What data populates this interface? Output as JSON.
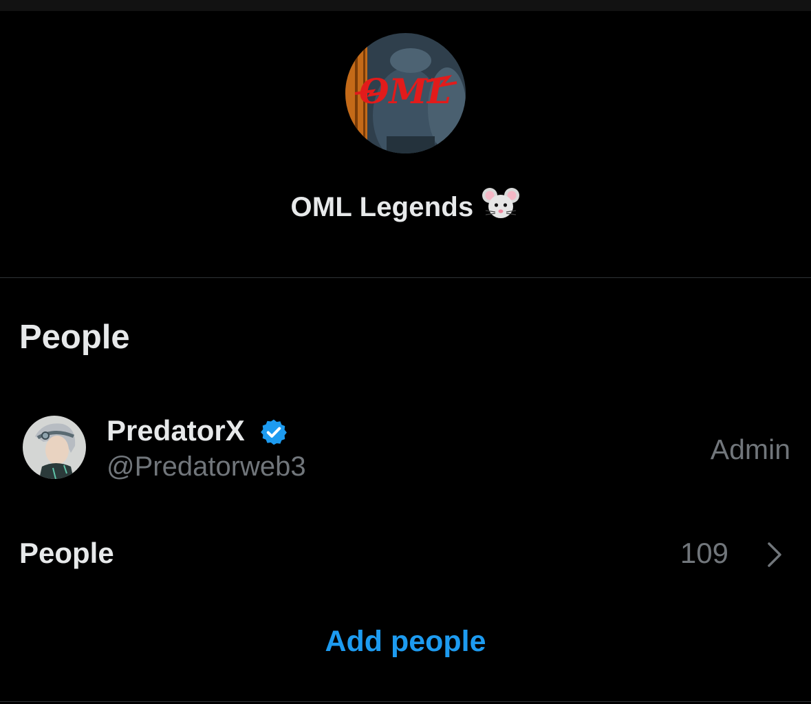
{
  "group": {
    "avatar_text": "OML",
    "title": "OML Legends",
    "title_emoji": "mouse-face-emoji"
  },
  "people_section": {
    "heading": "People"
  },
  "member": {
    "name": "PredatorX",
    "handle": "@Predatorweb3",
    "role": "Admin",
    "verified": true
  },
  "people_row": {
    "label": "People",
    "count": "109"
  },
  "add_people": {
    "label": "Add people"
  },
  "colors": {
    "background": "#000000",
    "primary_text": "#e7e9ea",
    "secondary_text": "#71767b",
    "accent": "#1d9bf0",
    "divider": "#2f3336"
  }
}
